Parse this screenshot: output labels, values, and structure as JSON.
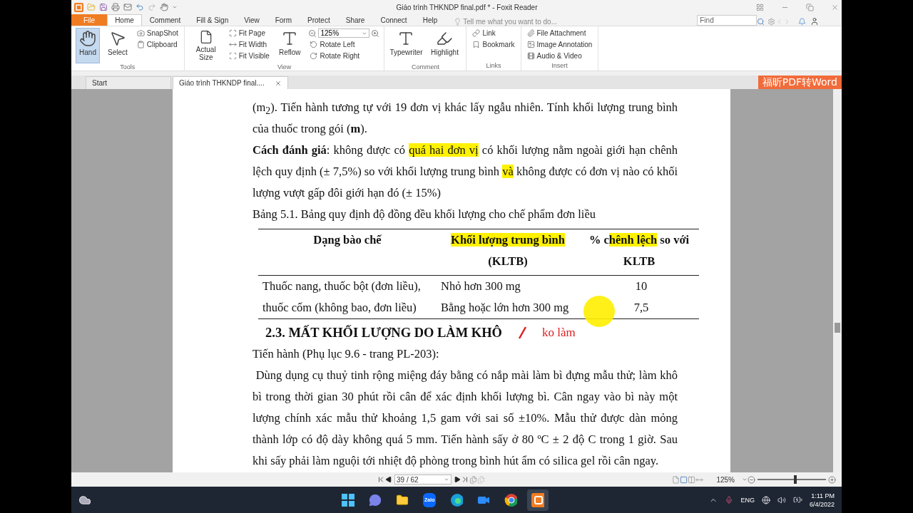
{
  "window": {
    "title": "Giáo trình THKNDP final.pdf * - Foxit Reader"
  },
  "menu": {
    "tabs": [
      {
        "label": "File",
        "kind": "file",
        "selected": false
      },
      {
        "label": "Home",
        "kind": "tab",
        "selected": true
      },
      {
        "label": "Comment",
        "kind": "tab",
        "selected": false
      },
      {
        "label": "Fill & Sign",
        "kind": "tab",
        "selected": false
      },
      {
        "label": "View",
        "kind": "tab",
        "selected": false
      },
      {
        "label": "Form",
        "kind": "tab",
        "selected": false
      },
      {
        "label": "Protect",
        "kind": "tab",
        "selected": false
      },
      {
        "label": "Share",
        "kind": "tab",
        "selected": false
      },
      {
        "label": "Connect",
        "kind": "tab",
        "selected": false
      },
      {
        "label": "Help",
        "kind": "tab",
        "selected": false
      }
    ],
    "tell_me": {
      "placeholder": "Tell me what you want to do..."
    },
    "find": {
      "placeholder": "Find"
    }
  },
  "ribbon": {
    "groups": [
      {
        "label": "Tools",
        "columns": [
          [
            {
              "label": "Hand",
              "kind": "large",
              "selected": true
            }
          ],
          [
            {
              "label": "Select",
              "kind": "large",
              "selected": false
            }
          ],
          [
            {
              "label": "SnapShot",
              "kind": "small"
            },
            {
              "label": "Clipboard",
              "kind": "small"
            }
          ]
        ]
      },
      {
        "label": "View",
        "columns": [
          [
            {
              "label": "Actual Size",
              "kind": "large",
              "selected": false
            }
          ],
          [
            {
              "label": "Fit Page",
              "kind": "small"
            },
            {
              "label": "Fit Width",
              "kind": "small"
            },
            {
              "label": "Fit Visible",
              "kind": "small"
            }
          ],
          [
            {
              "label": "Reflow",
              "kind": "large",
              "selected": false
            }
          ],
          [
            {
              "label": "125%",
              "kind": "zoom"
            },
            {
              "label": "Rotate Left",
              "kind": "small"
            },
            {
              "label": "Rotate Right",
              "kind": "small"
            }
          ]
        ]
      },
      {
        "label": "Comment",
        "columns": [
          [
            {
              "label": "Typewriter",
              "kind": "large",
              "selected": false
            }
          ],
          [
            {
              "label": "Highlight",
              "kind": "large",
              "selected": false
            }
          ]
        ]
      },
      {
        "label": "Links",
        "columns": [
          [
            {
              "label": "Link",
              "kind": "small"
            },
            {
              "label": "Bookmark",
              "kind": "small"
            }
          ]
        ]
      },
      {
        "label": "Insert",
        "columns": [
          [
            {
              "label": "File Attachment",
              "kind": "small"
            },
            {
              "label": "Image Annotation",
              "kind": "small"
            },
            {
              "label": "Audio & Video",
              "kind": "small"
            }
          ]
        ]
      }
    ]
  },
  "doc_tabs": [
    {
      "label": "Start",
      "selected": false
    },
    {
      "label": "Giáo trình THKNDP final....",
      "selected": true
    }
  ],
  "convert_button": "福昕PDF转Word",
  "page": {
    "blocks": [
      {
        "kind": "paragraph",
        "segments": [
          {
            "text": "(m$_{2}$). Tiến hành tương tự với 19 đơn vị khác lấy ngẫu nhiên. Tính khối lượng trung bình của thuốc trong gói (**m**).",
            "highlight": false
          }
        ]
      },
      {
        "kind": "paragraph",
        "segments": [
          {
            "text": "**Cách đánh giá**: không được có ",
            "highlight": false
          },
          {
            "text": "quá hai đơn vị",
            "highlight": true
          },
          {
            "text": " có khối lượng nằm ngoài giới hạn chênh lệch quy định (± 7,5%) so với khối lượng trung bình ",
            "highlight": false
          },
          {
            "text": "và",
            "highlight": true
          },
          {
            "text": " không được có đơn vị nào có khối lượng vượt gấp đôi giới hạn đó (± 15%)",
            "highlight": false
          }
        ]
      },
      {
        "kind": "caption",
        "text": "Bảng 5.1. Bảng quy định độ đồng đều khối lượng cho chế phẩm đơn liều"
      },
      {
        "kind": "table",
        "columns": [
          [
            {
              "text": "Dạng bào chế",
              "highlight": false
            }
          ],
          [
            {
              "text": "Khối lượng trung bình",
              "highlight": true
            },
            {
              "text": " (KLTB)",
              "highlight": false
            }
          ],
          [
            {
              "text": "% c",
              "highlight": false
            },
            {
              "text": "hênh lệch",
              "highlight": true
            },
            {
              "text": " so với KLTB",
              "highlight": false
            }
          ]
        ],
        "rows": [
          {
            "form": "Thuốc nang, thuốc bột (đơn liều), thuốc cốm (không bao, đơn liều)",
            "limits": [
              {
                "mass": "Nhỏ hơn 300 mg",
                "percent": "10"
              },
              {
                "mass": "Bằng hoặc lớn hơn 300 mg",
                "percent": "7,5"
              }
            ]
          }
        ]
      },
      {
        "kind": "heading",
        "text": "2.3. MẤT KHỐI LƯỢNG DO LÀM KHÔ",
        "note": "ko làm"
      },
      {
        "kind": "paragraph",
        "segments": [
          {
            "text": "Tiến hành (Phụ lục 9.6 - trang PL-203):",
            "highlight": false
          }
        ]
      },
      {
        "kind": "paragraph",
        "segments": [
          {
            "text": " Dùng dụng cụ thuỷ tinh rộng miệng đáy bằng có nắp mài làm bì đựng mẫu thử; làm khô bì trong thời gian 30 phút rồi cân để xác định khối lượng bì. Cân ngay vào bì này một lượng chính xác mẫu thử khoảng 1,5 gam với sai số ±10%. Mẫu thử được dàn mỏng thành lớp có độ dày không quá 5 mm. Tiến hành sấy ở 80 ºC ± 2 độ C trong 1 giờ. Sau khi sấy phải làm nguội tới nhiệt độ phòng trong bình hút ẩm có silica gel rồi cân ngay.",
            "highlight": false
          }
        ]
      }
    ]
  },
  "status_bar": {
    "page_field": "39 / 62",
    "zoom": "125%",
    "zoom_slider": {
      "level": 0.55
    }
  },
  "taskbar": {
    "apps": [
      {
        "kind": "start",
        "selected": false
      },
      {
        "kind": "chat",
        "selected": false
      },
      {
        "kind": "files",
        "selected": false
      },
      {
        "kind": "zalo",
        "label": "Zalo",
        "selected": false
      },
      {
        "kind": "edge",
        "selected": false
      },
      {
        "kind": "zoom",
        "selected": false
      },
      {
        "kind": "chrome",
        "selected": false
      },
      {
        "kind": "foxit",
        "selected": true
      }
    ],
    "language": "ENG",
    "time": "1:11 PM",
    "date": "6/4/2022"
  }
}
